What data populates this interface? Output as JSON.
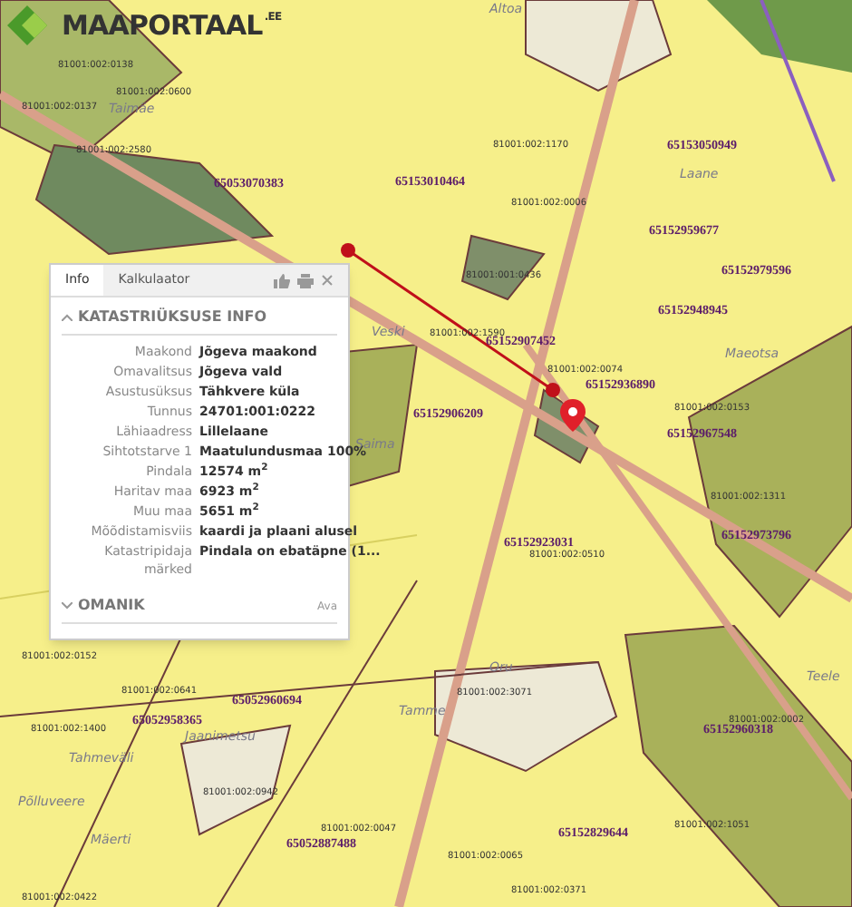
{
  "logo": {
    "name": "MAAPORTAAL",
    "suffix": ".EE"
  },
  "map": {
    "parcel_numbers": [
      "65053070383",
      "65153010464",
      "65153050949",
      "65152959677",
      "65152979596",
      "65152948945",
      "65152907452",
      "65152936890",
      "65152906209",
      "65152967548",
      "65152923031",
      "65152973796",
      "65152960318",
      "65152829644",
      "65052887488",
      "65052958365",
      "65052960694"
    ],
    "place_names": [
      "Veski",
      "Laane",
      "Maeotsa",
      "Teele",
      "Oru",
      "Tamme",
      "Jaanimetsu",
      "Tahmeväli",
      "Põlluveere",
      "Mäerti",
      "Saima",
      "Altoa",
      "Taimäe"
    ],
    "cadastral_codes": [
      "81001:002:0138",
      "81001:002:0137",
      "81001:002:0600",
      "81001:002:1170",
      "81001:002:0006",
      "81001:001:0436",
      "81001:002:1590",
      "81001:002:0074",
      "81001:002:0153",
      "81001:002:1311",
      "81001:002:0510",
      "81001:002:0002",
      "81001:002:3071",
      "81001:002:1400",
      "81001:002:0047",
      "81001:002:1051",
      "81001:002:0152",
      "81001:002:0641",
      "81001:002:0942",
      "81001:002:0422",
      "81001:002:0065",
      "81001:002:0371",
      "81001:002:2580"
    ]
  },
  "popup": {
    "tabs": [
      {
        "label": "Info",
        "selected": true
      },
      {
        "label": "Kalkulaator",
        "selected": false
      }
    ],
    "sections": [
      {
        "title": "KATASTRIÜKSUSE INFO",
        "expanded": true,
        "rows": [
          {
            "label": "Maakond",
            "value": "Jõgeva maakond"
          },
          {
            "label": "Omavalitsus",
            "value": "Jõgeva vald"
          },
          {
            "label": "Asustusüksus",
            "value": "Tähkvere küla"
          },
          {
            "label": "Tunnus",
            "value": "24701:001:0222"
          },
          {
            "label": "Lähiaadress",
            "value": "Lillelaane"
          },
          {
            "label": "Sihtotstarve 1",
            "value": "Maatulundusmaa 100%"
          },
          {
            "label": "Pindala",
            "value": "12574 m$^{2}$"
          },
          {
            "label": "Haritav maa",
            "value": "6923 m$^{2}$"
          },
          {
            "label": "Muu maa",
            "value": "5651 m$^{2}$"
          },
          {
            "label": "Mõõdistamisviis",
            "value": "kaardi ja plaani alusel"
          },
          {
            "label": "Katastripidaja märked",
            "value": "Pindala on ebatäpne (1..."
          }
        ]
      },
      {
        "title": "OMANIK",
        "expanded": false,
        "action": "Ava"
      }
    ]
  }
}
